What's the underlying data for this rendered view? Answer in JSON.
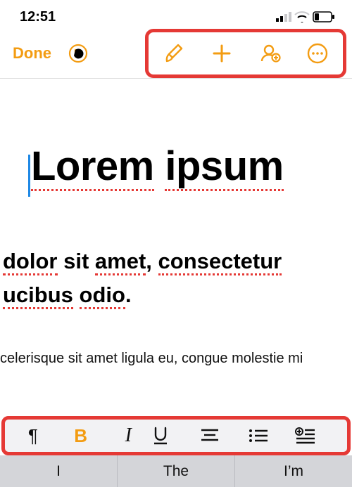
{
  "status": {
    "time": "12:51"
  },
  "toolbar": {
    "done_label": "Done"
  },
  "heading": {
    "w1": "Lorem",
    "w2": "ipsum"
  },
  "sub": {
    "line1_pre": " ",
    "line1_w1": "dolor",
    "line1_mid": " sit ",
    "line1_w2": "amet",
    "line1_post": ", ",
    "line1_w3": "consectetur",
    "line2_w1": "ucibus",
    "line2_mid": " ",
    "line2_w2": "odio",
    "line2_post": "."
  },
  "body": {
    "pre": "",
    "w1": "celerisque",
    "mid1": " sit ",
    "w2": "amet",
    "mid2": " ligula ",
    "w3": "eu",
    "mid3": ", congue ",
    "w4": "molestie",
    "post": " mi"
  },
  "format_bar": {
    "pilcrow": "¶",
    "bold": "B",
    "italic": "I"
  },
  "suggestions": [
    "I",
    "The",
    "I’m"
  ]
}
